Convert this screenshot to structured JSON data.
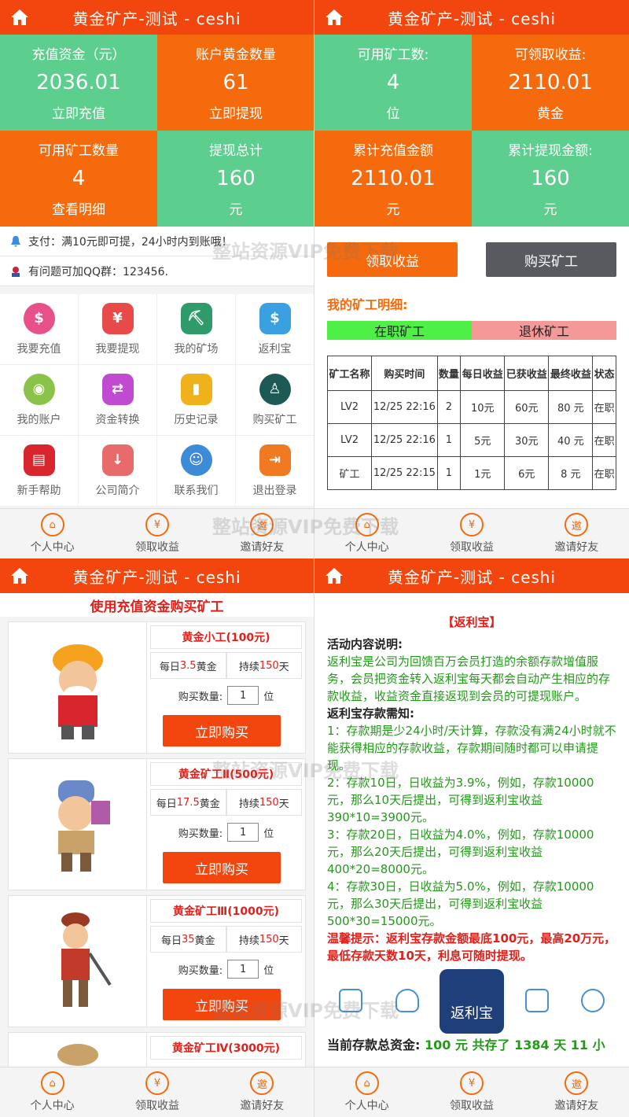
{
  "app_title": "黄金矿产-测试 - ceshi",
  "p1": {
    "stats": [
      {
        "title": "充值资金（元）",
        "value": "2036.01",
        "sub": "立即充值"
      },
      {
        "title": "账户黄金数量",
        "value": "61",
        "sub": "立即提现"
      },
      {
        "title": "可用矿工数量",
        "value": "4",
        "sub": "查看明细"
      },
      {
        "title": "提现总计",
        "value": "160",
        "sub": "元"
      }
    ],
    "notice1": "支付：满10元即可提，24小时内到账哦！",
    "notice2": "有问题可加QQ群：123456.",
    "menu": [
      "我要充值",
      "我要提现",
      "我的矿场",
      "返利宝",
      "我的账户",
      "资金转换",
      "历史记录",
      "购买矿工",
      "新手帮助",
      "公司简介",
      "联系我们",
      "退出登录"
    ]
  },
  "p2": {
    "stats": [
      {
        "title": "可用矿工数:",
        "value": "4",
        "sub": "位"
      },
      {
        "title": "可领取收益:",
        "value": "2110.01",
        "sub": "黄金"
      },
      {
        "title": "累计充值金额",
        "value": "2110.01",
        "sub": "元"
      },
      {
        "title": "累计提现金额:",
        "value": "160",
        "sub": "元"
      }
    ],
    "btn_collect": "领取收益",
    "btn_buy": "购买矿工",
    "section": "我的矿工明细:",
    "seg_active": "在职矿工",
    "seg_retired": "退休矿工",
    "headers": [
      "矿工名称",
      "购买时间",
      "数量",
      "每日收益",
      "已获收益",
      "最终收益",
      "状态"
    ],
    "rows": [
      [
        "LV2",
        "12/25 22:16",
        "2",
        "10元",
        "60元",
        "80 元",
        "在职"
      ],
      [
        "LV2",
        "12/25 22:16",
        "1",
        "5元",
        "30元",
        "40 元",
        "在职"
      ],
      [
        "矿工",
        "12/25 22:15",
        "1",
        "1元",
        "6元",
        "8 元",
        "在职"
      ]
    ]
  },
  "p3": {
    "subtitle": "使用充值资金购买矿工",
    "qty_label": "购买数量:",
    "qty_unit": "位",
    "qty_value": "1",
    "buy_label": "立即购买",
    "products": [
      {
        "name": "黄金小工(100元)",
        "daily_pre": "每日",
        "daily_num": "3.5",
        "daily_post": "黄金",
        "dur_pre": "持续",
        "dur_num": "150",
        "dur_post": "天"
      },
      {
        "name": "黄金矿工Ⅱ(500元)",
        "daily_pre": "每日",
        "daily_num": "17.5",
        "daily_post": "黄金",
        "dur_pre": "持续",
        "dur_num": "150",
        "dur_post": "天"
      },
      {
        "name": "黄金矿工Ⅲ(1000元)",
        "daily_pre": "每日",
        "daily_num": "35",
        "daily_post": "黄金",
        "dur_pre": "持续",
        "dur_num": "150",
        "dur_post": "天"
      },
      {
        "name": "黄金矿工Ⅳ(3000元)"
      }
    ]
  },
  "p4": {
    "title": "【返利宝】",
    "h1": "活动内容说明:",
    "desc": "返利宝是公司为回馈百万会员打造的余额存款增值服务，会员把资金转入返利宝每天都会自动产生相应的存款收益，收益资金直接返现到会员的可提现账户。",
    "h2": "返利宝存款需知:",
    "items": [
      "1：存款期是少24小时/天计算，存款没有满24小时就不能获得相应的存款收益，存款期间随时都可以申请提现。",
      "2：存款10日，日收益为3.9%，例如，存款10000元，那么10天后提出，可得到返利宝收益390*10=3900元。",
      "3：存款20日，日收益为4.0%，例如，存款10000元，那么20天后提出，可得到返利宝收益400*20=8000元。",
      "4：存款30日，日收益为5.0%，例如，存款10000元，那么30天后提出，可得到返利宝收益500*30=15000元。"
    ],
    "tip": "温馨提示：返利宝存款金额最底100元，最高20万元，最低存款天数10天，利息可随时提现。",
    "logo_main": "返利宝",
    "total_label": "当前存款总资金:",
    "total_value": "100 元 共存了 1384 天 11 小"
  },
  "tabs": [
    "个人中心",
    "领取收益",
    "邀请好友"
  ],
  "tab_icons": [
    "⌂",
    "¥",
    "邀"
  ],
  "watermark": "整站资源VIP免费下载"
}
